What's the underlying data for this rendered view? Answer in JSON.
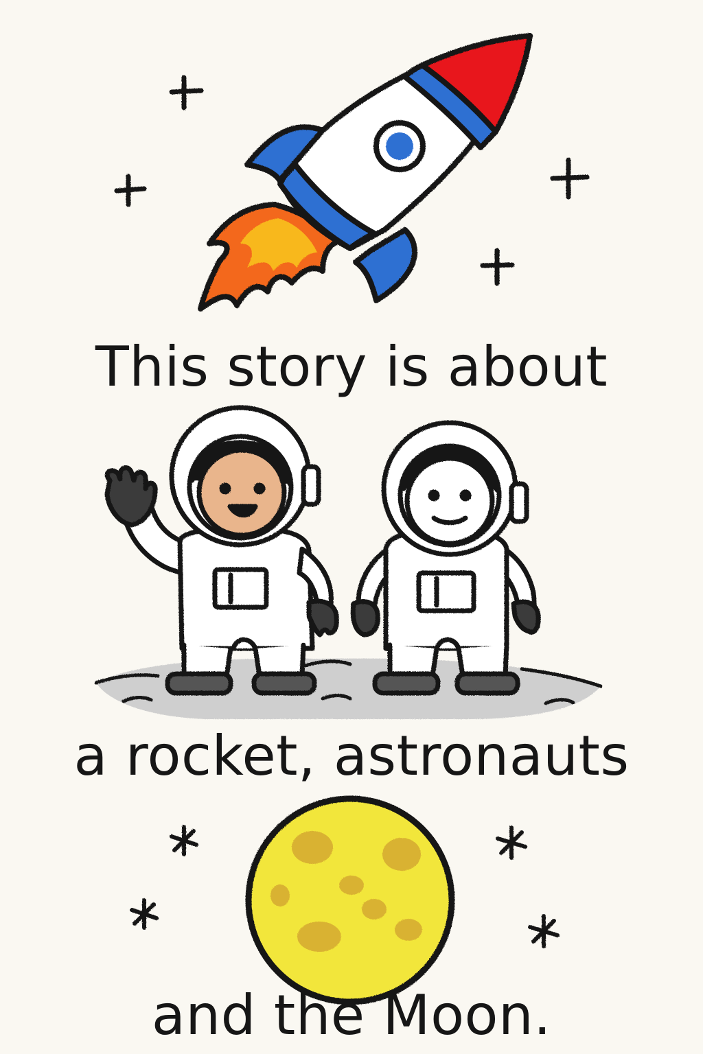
{
  "story": {
    "lines": [
      "This story is about",
      "a rocket, astronauts",
      "and the Moon."
    ]
  },
  "illustrations": {
    "rocket": "rocket-illustration",
    "astronauts": "astronauts-illustration",
    "moon": "moon-illustration",
    "stars": "star-icon"
  },
  "colors": {
    "background": "#faf8f2",
    "ink": "#161616",
    "rocket_nose": "#e8161b",
    "rocket_blue": "#2f6fd2",
    "flame_orange": "#f3671d",
    "flame_yellow": "#f8b81f",
    "skin": "#e9b58c",
    "moon_yellow": "#f2e63a",
    "moon_crater": "#d9b233",
    "ground_gray": "#cfcfcf"
  }
}
